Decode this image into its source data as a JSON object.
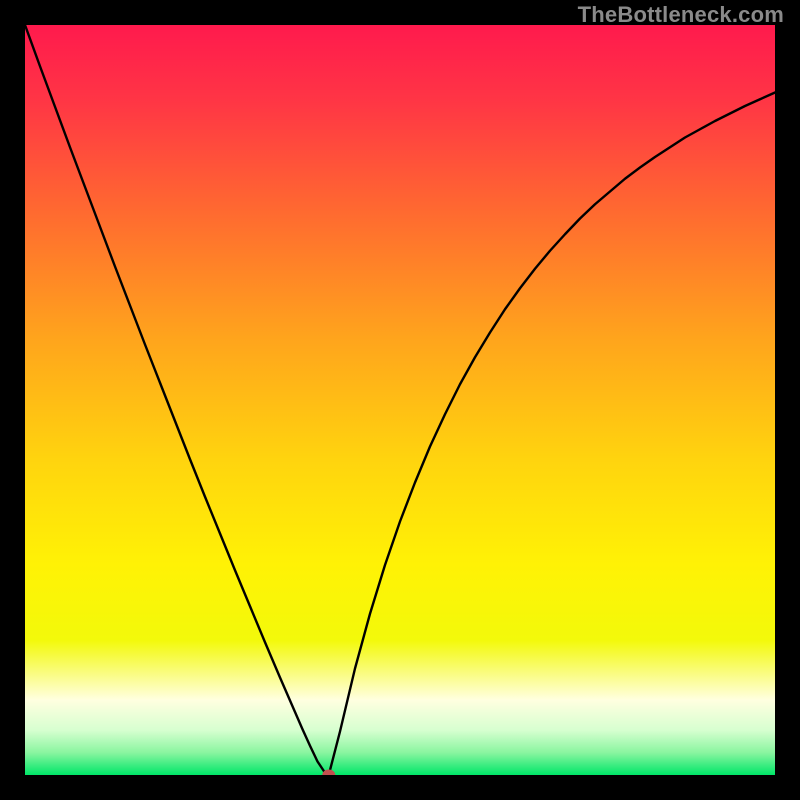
{
  "watermark": "TheBottleneck.com",
  "chart_data": {
    "type": "line",
    "title": "",
    "xlabel": "",
    "ylabel": "",
    "x_range": [
      0,
      100
    ],
    "y_range": [
      0,
      100
    ],
    "grid": false,
    "legend": false,
    "background_gradient": [
      "#ff1a4d",
      "#ffef00",
      "#00e668"
    ],
    "minimum_x": 40.5,
    "minimum_y": 0,
    "minimum_marker": {
      "shape": "ellipse",
      "color": "#c24f4f"
    },
    "series": [
      {
        "name": "bottleneck-curve",
        "x": [
          0,
          2,
          4,
          6,
          8,
          10,
          12,
          14,
          16,
          18,
          20,
          22,
          24,
          26,
          28,
          30,
          32,
          34,
          36,
          37,
          38,
          39,
          40,
          40.5,
          42,
          44,
          46,
          48,
          50,
          52,
          54,
          56,
          58,
          60,
          62,
          64,
          66,
          68,
          70,
          72,
          74,
          76,
          78,
          80,
          82,
          84,
          86,
          88,
          90,
          92,
          94,
          96,
          98,
          100
        ],
        "y": [
          100,
          94.5,
          89.1,
          83.7,
          78.4,
          73.1,
          67.8,
          62.6,
          57.4,
          52.3,
          47.2,
          42.1,
          37.1,
          32.2,
          27.3,
          22.5,
          17.7,
          13.0,
          8.4,
          6.1,
          3.9,
          1.8,
          0.3,
          0,
          5.8,
          14.2,
          21.5,
          28.0,
          33.8,
          39.0,
          43.8,
          48.1,
          52.1,
          55.7,
          59.0,
          62.1,
          64.9,
          67.5,
          69.9,
          72.1,
          74.2,
          76.1,
          77.8,
          79.5,
          81.0,
          82.4,
          83.7,
          85.0,
          86.1,
          87.2,
          88.2,
          89.2,
          90.1,
          91.0
        ]
      }
    ]
  }
}
